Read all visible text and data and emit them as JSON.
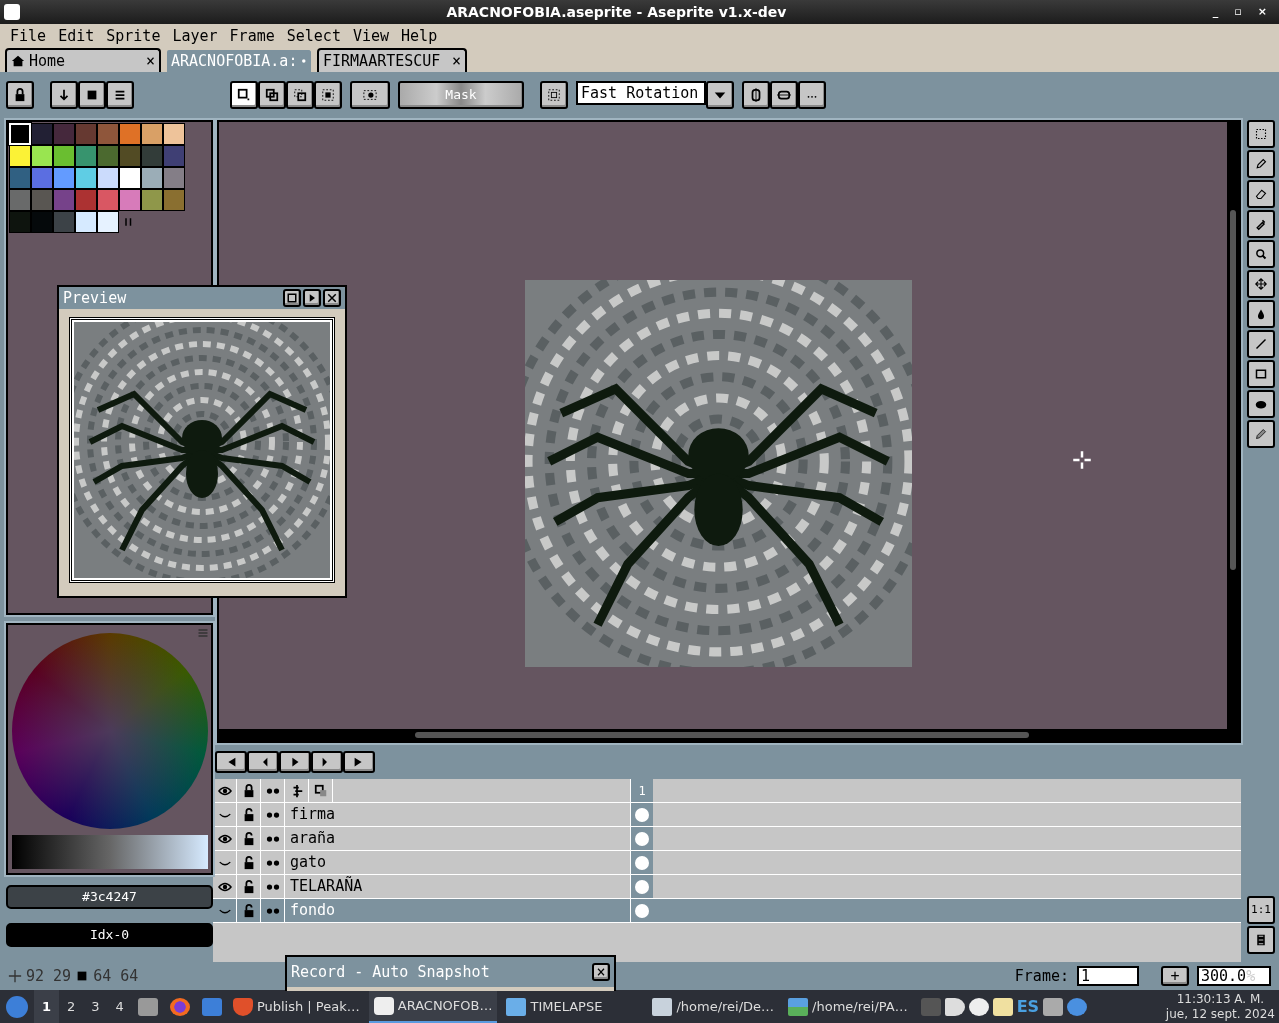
{
  "window": {
    "title": "ARACNOFOBIA.aseprite - Aseprite v1.x-dev",
    "controls": [
      "_",
      "▫",
      "×"
    ]
  },
  "menu": [
    "File",
    "Edit",
    "Sprite",
    "Layer",
    "Frame",
    "Select",
    "View",
    "Help"
  ],
  "tabs": [
    {
      "label": "Home",
      "kind": "home",
      "selected": false,
      "modified": false,
      "close": "×"
    },
    {
      "label": "ARACNOFOBIA.a:",
      "kind": "file",
      "selected": true,
      "modified": true
    },
    {
      "label": "FIRMAARTESCUF",
      "kind": "file",
      "selected": false,
      "modified": false,
      "close": "×"
    }
  ],
  "toolbar": {
    "selection_modes": [
      {
        "selected": true
      },
      {
        "selected": false
      },
      {
        "selected": false
      },
      {
        "selected": false
      }
    ],
    "mask_button": "Mask",
    "rotation": "Fast Rotation"
  },
  "palette": [
    {
      "color": "#000000",
      "selected": true
    },
    {
      "color": "#222034",
      "selected": false
    },
    {
      "color": "#45283c",
      "selected": false
    },
    {
      "color": "#663931",
      "selected": false
    },
    {
      "color": "#8f563b",
      "selected": false
    },
    {
      "color": "#df7126",
      "selected": false
    },
    {
      "color": "#d9a066",
      "selected": false
    },
    {
      "color": "#eec39a",
      "selected": false
    },
    {
      "color": "#fbf236",
      "selected": false
    },
    {
      "color": "#99e550",
      "selected": false
    },
    {
      "color": "#6abe30",
      "selected": false
    },
    {
      "color": "#37946e",
      "selected": false
    },
    {
      "color": "#4b692f",
      "selected": false
    },
    {
      "color": "#524b24",
      "selected": false
    },
    {
      "color": "#323c39",
      "selected": false
    },
    {
      "color": "#3f3f74",
      "selected": false
    },
    {
      "color": "#306082",
      "selected": false
    },
    {
      "color": "#5b6ee1",
      "selected": false
    },
    {
      "color": "#639bff",
      "selected": false
    },
    {
      "color": "#5fcde4",
      "selected": false
    },
    {
      "color": "#cbdbfc",
      "selected": false
    },
    {
      "color": "#ffffff",
      "selected": false
    },
    {
      "color": "#9badb7",
      "selected": false
    },
    {
      "color": "#847e87",
      "selected": false
    },
    {
      "color": "#696a6a",
      "selected": false
    },
    {
      "color": "#595652",
      "selected": false
    },
    {
      "color": "#76428a",
      "selected": false
    },
    {
      "color": "#ac3232",
      "selected": false
    },
    {
      "color": "#d95763",
      "selected": false
    },
    {
      "color": "#d77bba",
      "selected": false
    },
    {
      "color": "#8f974a",
      "selected": false
    },
    {
      "color": "#8a6f30",
      "selected": false
    },
    {
      "color": "#0e140e",
      "selected": false
    },
    {
      "color": "#05090b",
      "selected": false
    },
    {
      "color": "#3c4247",
      "selected": false
    },
    {
      "color": "#d6eaff",
      "selected": false
    },
    {
      "color": "#e6f2ff",
      "selected": false
    }
  ],
  "preview": {
    "title": "Preview"
  },
  "color_bar": {
    "hex": "#3c4247",
    "index": "Idx-0"
  },
  "status": {
    "position": "92 29",
    "size": "64 64"
  },
  "timeline": {
    "frame_header": "1",
    "layers": [
      {
        "name": "firma",
        "visible": false,
        "selected": false
      },
      {
        "name": "araña",
        "visible": true,
        "selected": false
      },
      {
        "name": "gato",
        "visible": false,
        "selected": false
      },
      {
        "name": "TELARAÑA",
        "visible": true,
        "selected": false
      },
      {
        "name": "fondo",
        "visible": false,
        "selected": true
      }
    ]
  },
  "actual_size": "1:1",
  "record": {
    "title": "Record - Auto Snapshot",
    "close": "×"
  },
  "frame_bar": {
    "label": "Frame:",
    "frame": "1",
    "add": "+",
    "zoom": "300.0",
    "zoom_unit": "%"
  },
  "taskbar": {
    "workspaces": [
      {
        "label": "1",
        "selected": true
      },
      {
        "label": "2",
        "selected": false
      },
      {
        "label": "3",
        "selected": false
      },
      {
        "label": "4",
        "selected": false
      }
    ],
    "tasks": [
      {
        "label": "Publish | Peak…",
        "kind": "shield",
        "selected": false
      },
      {
        "label": "ARACNOFOB…",
        "kind": "app",
        "selected": true
      },
      {
        "label": "TIMELAPSE",
        "kind": "folder",
        "selected": false
      },
      {
        "label": "/home/rei/De…",
        "kind": "feather",
        "selected": false
      },
      {
        "label": "/home/rei/PA…",
        "kind": "image",
        "selected": false
      }
    ],
    "language": "ES",
    "time": "11:30:13 A. M.",
    "date": "jue, 12 sept. 2024"
  }
}
